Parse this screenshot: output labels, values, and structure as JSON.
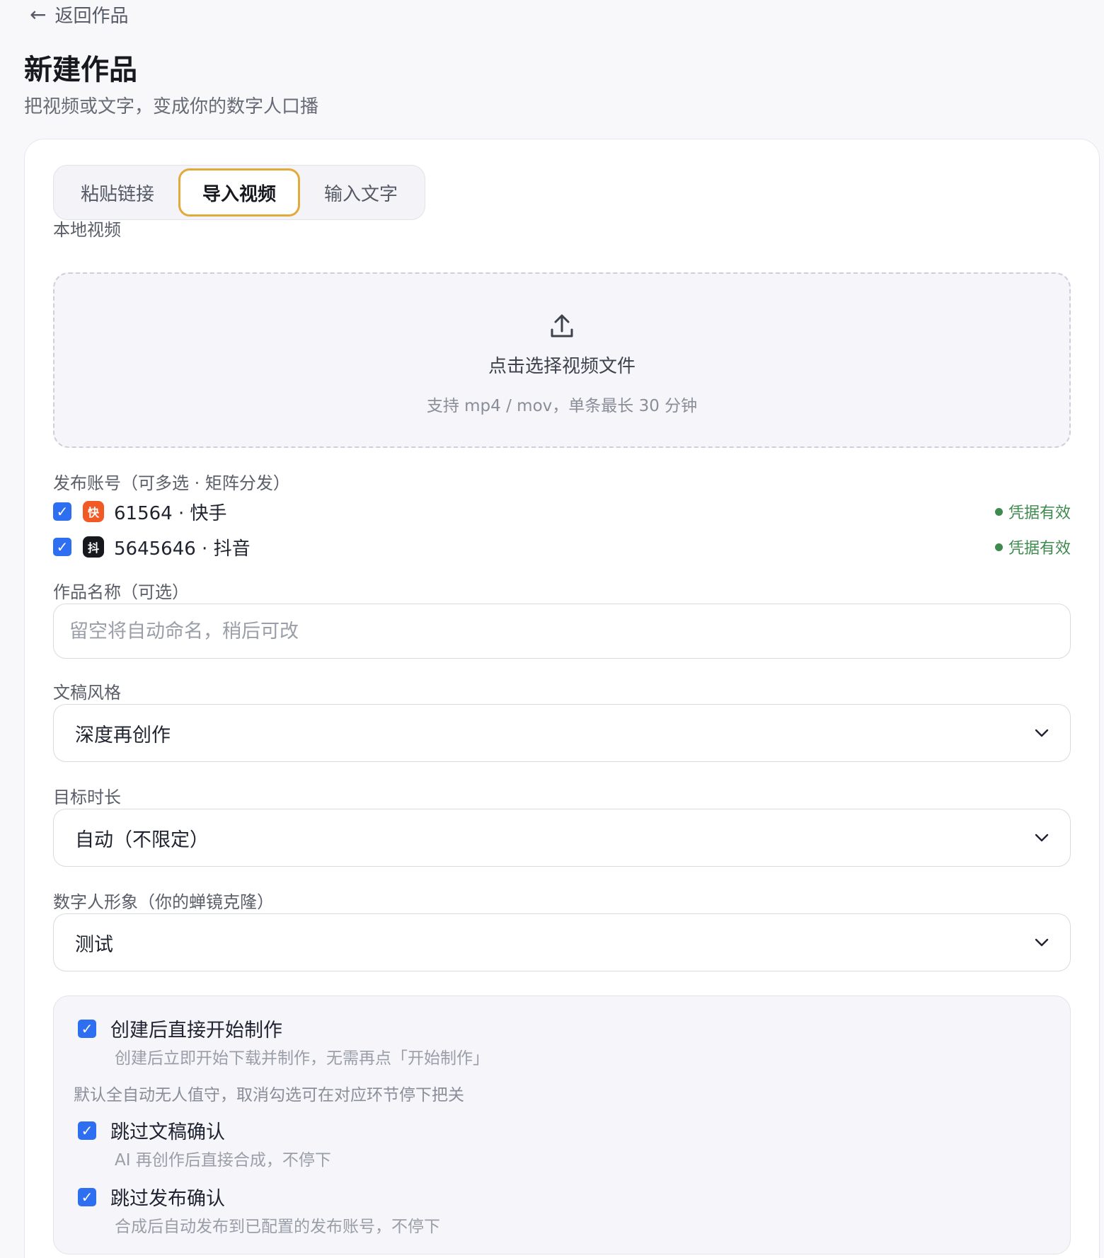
{
  "header": {
    "back_label": "返回作品",
    "title": "新建作品",
    "subtitle": "把视频或文字，变成你的数字人口播"
  },
  "tabs": [
    {
      "label": "粘贴链接",
      "active": false
    },
    {
      "label": "导入视频",
      "active": true
    },
    {
      "label": "输入文字",
      "active": false
    }
  ],
  "upload": {
    "section_label": "本地视频",
    "title": "点击选择视频文件",
    "hint": "支持 mp4 / mov，单条最长 30 分钟",
    "icon": "upload-icon"
  },
  "accounts": {
    "section_label": "发布账号（可多选 · 矩阵分发）",
    "items": [
      {
        "name": "61564 · 快手",
        "badge": "快",
        "badge_color": "#f15a24",
        "checked": true,
        "status": "凭据有效"
      },
      {
        "name": "5645646 · 抖音",
        "badge": "抖",
        "badge_color": "#16181d",
        "checked": true,
        "status": "凭据有效"
      }
    ]
  },
  "work_name": {
    "label": "作品名称（可选）",
    "placeholder": "留空将自动命名，稍后可改",
    "value": ""
  },
  "script_style": {
    "label": "文稿风格",
    "value": "深度再创作"
  },
  "target_duration": {
    "label": "目标时长",
    "value": "自动（不限定）"
  },
  "avatar": {
    "label": "数字人形象（你的蝉镜克隆）",
    "value": "测试"
  },
  "options": {
    "start_immediately": {
      "title": "创建后直接开始制作",
      "desc": "创建后立即开始下载并制作，无需再点「开始制作」",
      "checked": true
    },
    "note": "默认全自动无人值守，取消勾选可在对应环节停下把关",
    "skip_script_confirm": {
      "title": "跳过文稿确认",
      "desc": "AI 再创作后直接合成，不停下",
      "checked": true
    },
    "skip_publish_confirm": {
      "title": "跳过发布确认",
      "desc": "合成后自动发布到已配置的发布账号，不停下",
      "checked": true
    }
  },
  "colors": {
    "accent": "#2d6ff0",
    "active_tab_border": "#e2a93b",
    "status_ok": "#3f8a4f"
  }
}
